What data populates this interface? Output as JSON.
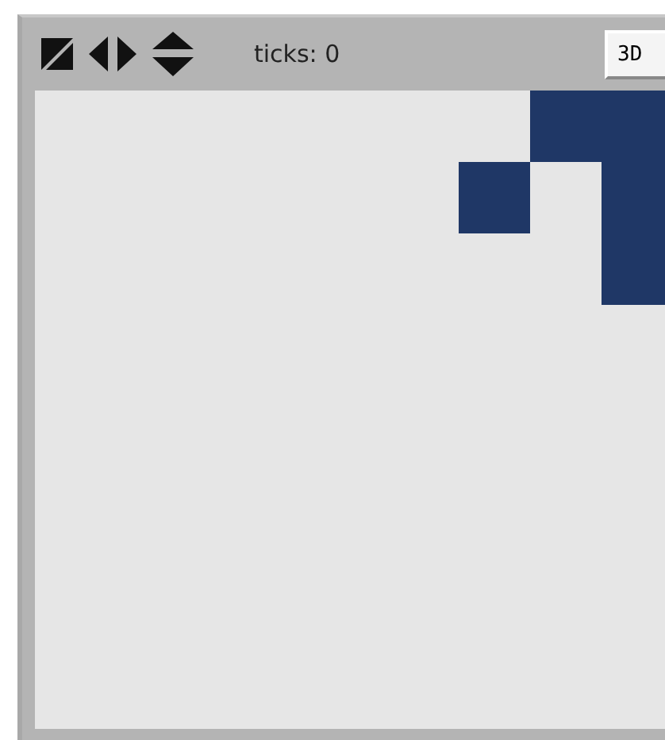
{
  "toolbar": {
    "ticks_label": "ticks: 0",
    "button": "3D"
  },
  "view": {
    "rows": [
      {
        "cells": [
          false,
          false,
          false,
          false,
          false,
          false,
          false,
          true,
          true
        ]
      },
      {
        "cells": [
          false,
          false,
          false,
          false,
          false,
          false,
          true,
          false,
          true
        ]
      },
      {
        "cells": [
          false,
          false,
          false,
          false,
          false,
          false,
          false,
          false,
          true
        ]
      }
    ]
  }
}
